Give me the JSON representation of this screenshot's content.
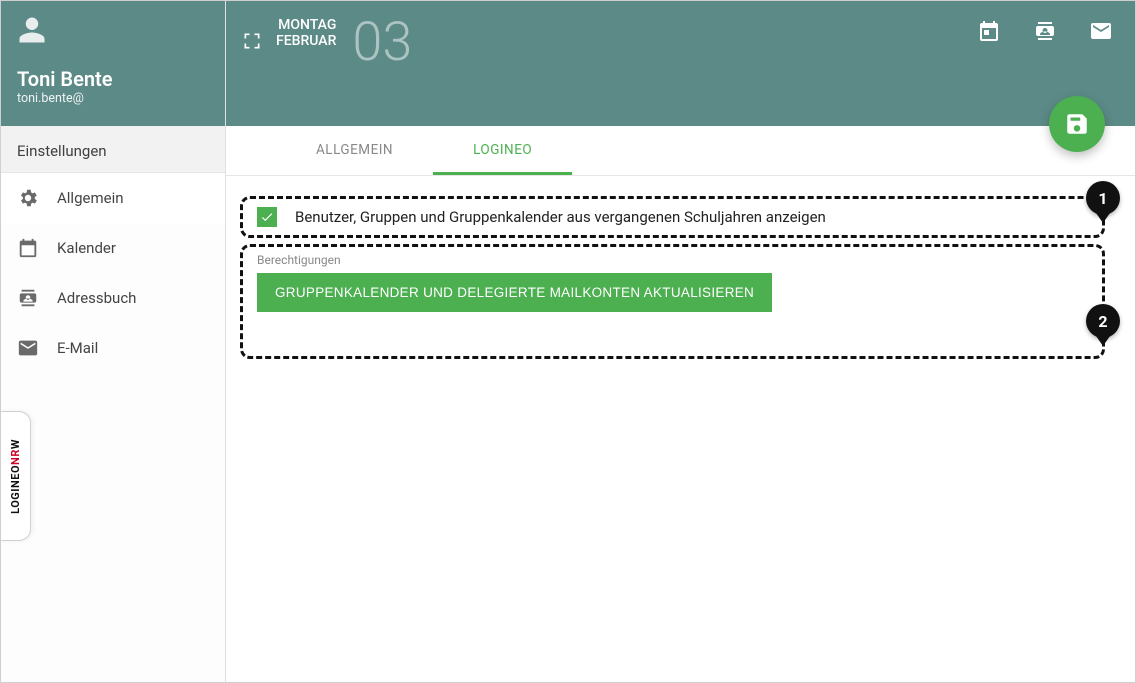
{
  "profile": {
    "name": "Toni Bente",
    "email": "toni.bente@"
  },
  "sidebar": {
    "section_title": "Einstellungen",
    "items": [
      {
        "label": "Allgemein"
      },
      {
        "label": "Kalender"
      },
      {
        "label": "Adressbuch"
      },
      {
        "label": "E-Mail"
      }
    ]
  },
  "side_tab": {
    "part1": "LOGINEO",
    "part2": "NR",
    "part3": "W"
  },
  "header": {
    "day_of_week": "MONTAG",
    "month": "FEBRUAR",
    "day_number": "03"
  },
  "tabs": {
    "allgemein": "ALLGEMEIN",
    "logineo": "LOGINEO"
  },
  "settings": {
    "checkbox_label": "Benutzer, Gruppen und Gruppenkalender aus vergangenen Schuljahren anzeigen",
    "checkbox_checked": true,
    "permissions_label": "Berechtigungen",
    "update_button": "GRUPPENKALENDER UND DELEGIERTE MAILKONTEN AKTUALISIEREN"
  },
  "annotations": {
    "marker1": "1",
    "marker2": "2"
  }
}
